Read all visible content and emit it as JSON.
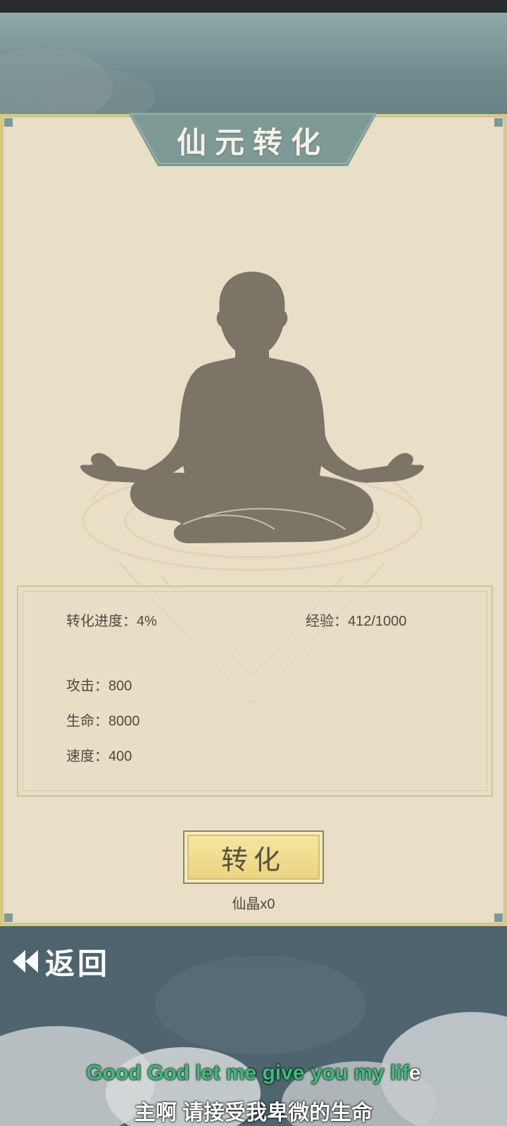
{
  "title": "仙元转化",
  "stats": {
    "progress_label": "转化进度：",
    "progress_value": "4%",
    "exp_label": "经验：",
    "exp_value": "412/1000",
    "attack_label": "攻击：",
    "attack_value": "800",
    "hp_label": "生命：",
    "hp_value": "8000",
    "speed_label": "速度：",
    "speed_value": "400"
  },
  "convert_button": {
    "label": "转化"
  },
  "cost": {
    "text": "仙晶x0"
  },
  "back_button": {
    "label": "返回",
    "icon": "double-left-arrow-icon"
  },
  "subtitles": {
    "english_highlight": "Good God let me give you my lif",
    "english_rest": "e",
    "chinese": "主啊 请接受我卑微的生命"
  },
  "colors": {
    "panel_bg": "#e9dfc6",
    "panel_border": "#d9cc72",
    "banner": "#7e9a96",
    "silhouette": "#7c7467",
    "button_gold": "#ecd783",
    "subtitle_highlight": "#37c07a"
  }
}
